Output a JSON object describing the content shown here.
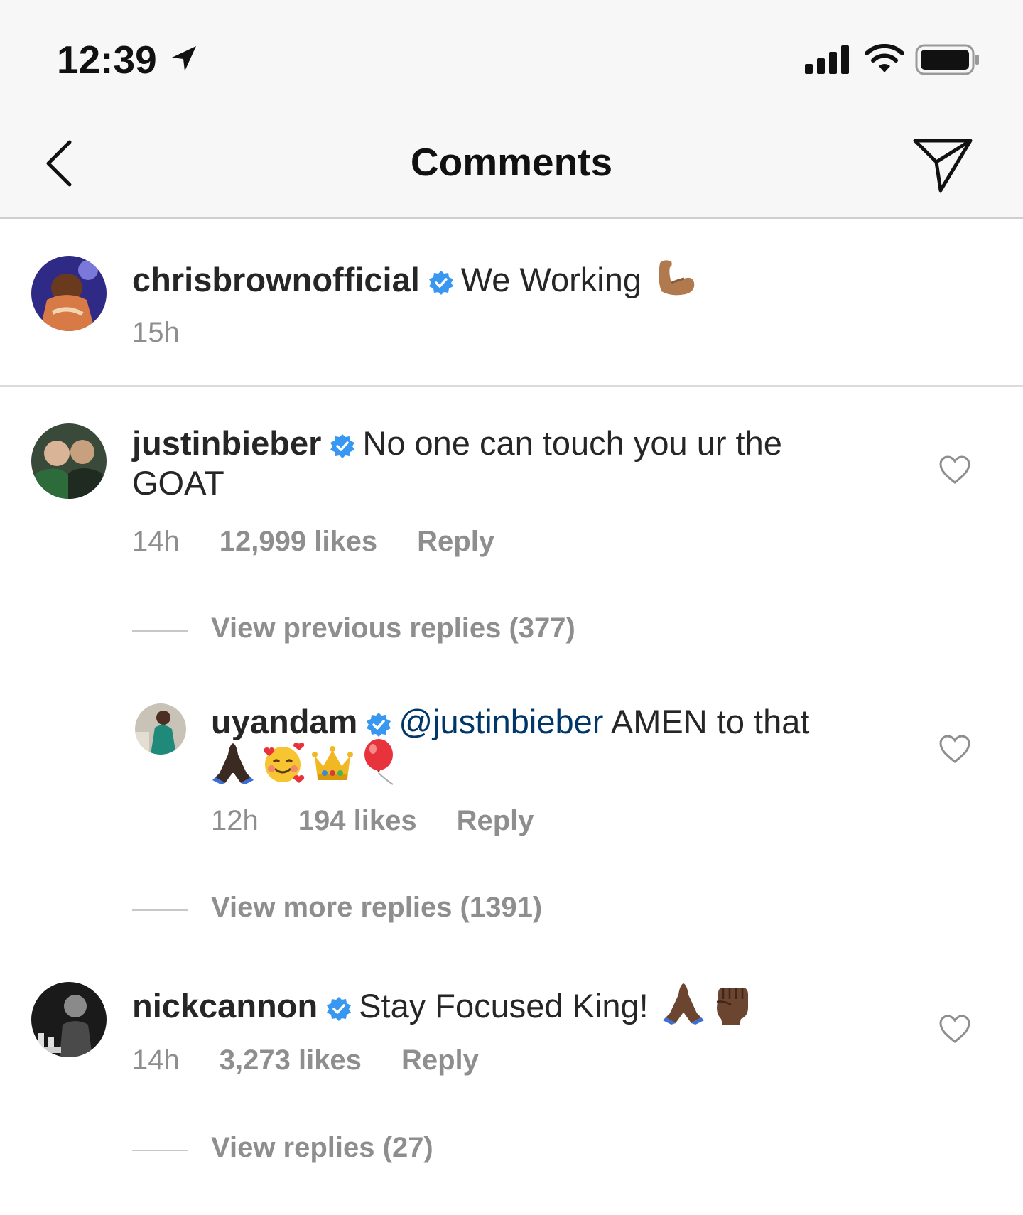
{
  "status_bar": {
    "time": "12:39",
    "icons": [
      "location-arrow-icon",
      "signal-bars-icon",
      "wifi-icon",
      "battery-icon"
    ]
  },
  "nav": {
    "title": "Comments",
    "back_icon": "chevron-left-icon",
    "send_icon": "paper-plane-icon"
  },
  "caption": {
    "username": "chrisbrownofficial",
    "text": "We Working",
    "emoji": "flexed-biceps",
    "time": "15h"
  },
  "comments": [
    {
      "username": "justinbieber",
      "text_line1": "No one can touch you ur the",
      "text_line2": "GOAT",
      "time": "14h",
      "likes": "12,999 likes",
      "reply": "Reply",
      "view_link": "View previous replies (377)"
    },
    {
      "username": "uyandam",
      "mention": "@justinbieber",
      "text": "AMEN to that",
      "emojis": [
        "folded-hands",
        "smiling-face-with-hearts",
        "crown",
        "balloon"
      ],
      "time": "12h",
      "likes": "194 likes",
      "reply": "Reply",
      "view_link": "View more replies (1391)"
    },
    {
      "username": "nickcannon",
      "text": "Stay Focused King!",
      "emojis": [
        "folded-hands",
        "raised-fist"
      ],
      "time": "14h",
      "likes": "3,273 likes",
      "reply": "Reply",
      "view_link": "View replies (27)"
    }
  ],
  "colors": {
    "verified_blue": "#3897f0",
    "mention_blue": "#00376b",
    "meta_gray": "#8e8e8e",
    "bar_bg": "#f7f7f7"
  }
}
